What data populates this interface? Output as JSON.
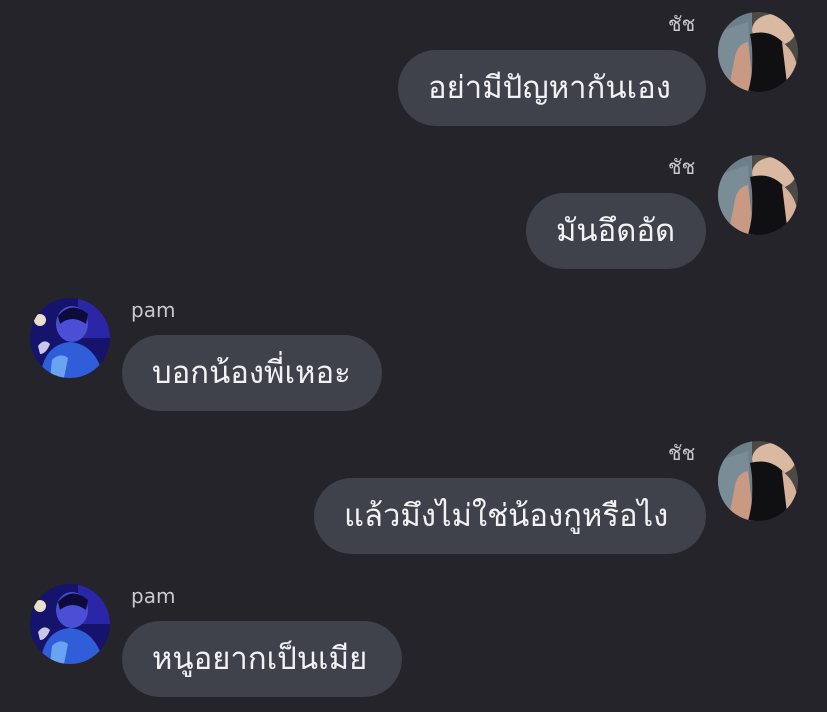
{
  "messages": [
    {
      "side": "right",
      "sender": "ชัช",
      "avatar_icon": "user-photo-avatar",
      "text": "อย่ามีปัญหากันเอง"
    },
    {
      "side": "right",
      "sender": "ชัช",
      "avatar_icon": "user-photo-avatar",
      "text": "มันอึดอัด"
    },
    {
      "side": "left",
      "sender": "pam",
      "avatar_icon": "contact-photo-avatar",
      "text": "บอกน้องพี่เหอะ"
    },
    {
      "side": "right",
      "sender": "ชัช",
      "avatar_icon": "user-photo-avatar",
      "text": "แล้วมึงไม่ใช่น้องกูหรือไง"
    },
    {
      "side": "left",
      "sender": "pam",
      "avatar_icon": "contact-photo-avatar",
      "text": "หนูอยากเป็นเมีย"
    }
  ],
  "colors": {
    "background": "#24242a",
    "bubble": "#3f414b",
    "text": "#f2f2f4",
    "name": "#c9c9cd"
  }
}
